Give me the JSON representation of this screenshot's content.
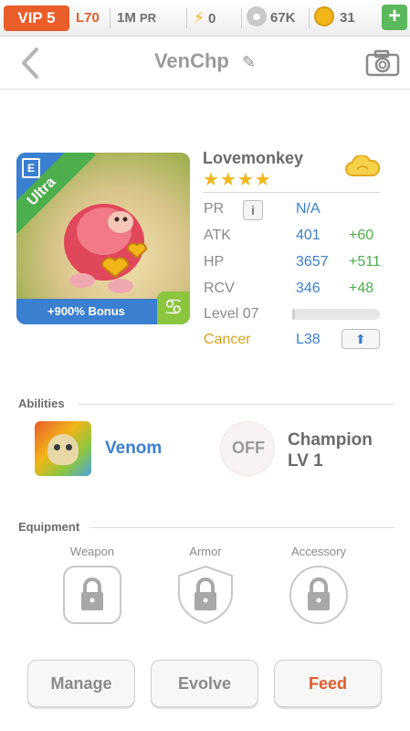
{
  "topbar": {
    "vip": "VIP 5",
    "level": "L70",
    "pr_value": "1M",
    "pr_unit": "PR",
    "energy": "0",
    "paws": "67K",
    "gold": "31",
    "plus": "+"
  },
  "nav": {
    "title": "VenChp",
    "edit_icon": "pencil-icon",
    "camera_icon": "camera-icon",
    "back_icon": "chevron-left-icon"
  },
  "pet": {
    "name": "Lovemonkey",
    "stars": "★★★★",
    "rarity": "Ultra",
    "bonus": "+900% Bonus",
    "element_badge": "E",
    "zodiac_symbol": "♋",
    "stats": {
      "pr_label": "PR",
      "pr_value": "N/A",
      "atk_label": "ATK",
      "atk_value": "401",
      "atk_plus": "+60",
      "hp_label": "HP",
      "hp_value": "3657",
      "hp_plus": "+511",
      "rcv_label": "RCV",
      "rcv_value": "346",
      "rcv_plus": "+48",
      "level_label": "Level 07",
      "level_progress": 0.03,
      "zodiac_label": "Cancer",
      "zodiac_level": "L38"
    },
    "info_button": "i"
  },
  "abilities": {
    "header": "Abilities",
    "first": {
      "name": "Venom"
    },
    "second": {
      "status": "OFF",
      "name_line1": "Champion",
      "name_line2": "LV 1"
    }
  },
  "equipment": {
    "header": "Equipment",
    "slots": [
      {
        "label": "Weapon"
      },
      {
        "label": "Armor"
      },
      {
        "label": "Accessory"
      }
    ]
  },
  "actions": {
    "manage": "Manage",
    "evolve": "Evolve",
    "feed": "Feed"
  },
  "colors": {
    "accent_orange": "#e05b2a",
    "blue": "#3a7fd0",
    "green": "#4cae4c",
    "gold": "#f2b51a"
  }
}
